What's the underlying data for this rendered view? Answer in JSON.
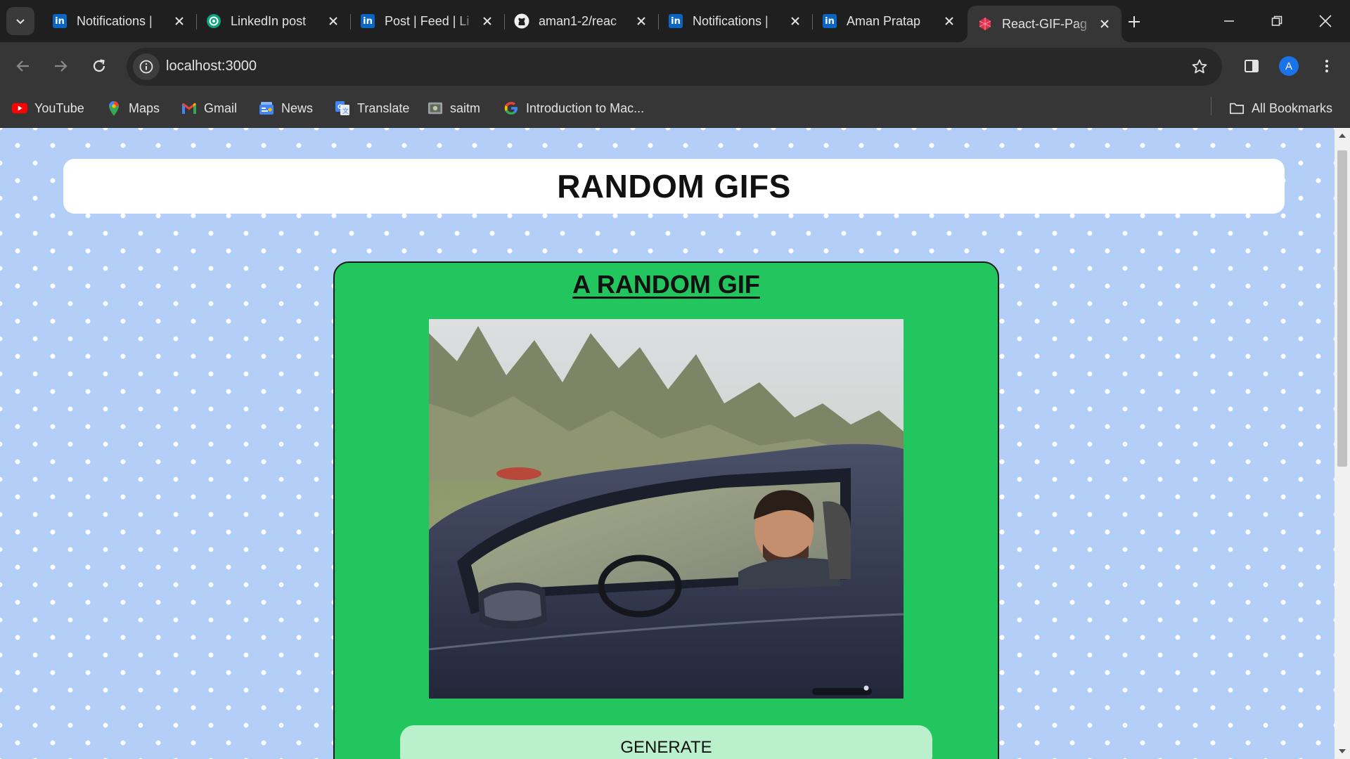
{
  "browser": {
    "tabs": [
      {
        "title": "Notifications |",
        "icon": "linkedin-icon"
      },
      {
        "title": "LinkedIn post",
        "icon": "chatgpt-icon"
      },
      {
        "title": "Post | Feed | Li",
        "icon": "linkedin-icon"
      },
      {
        "title": "aman1-2/reac",
        "icon": "github-icon"
      },
      {
        "title": "Notifications |",
        "icon": "linkedin-icon"
      },
      {
        "title": "Aman Pratap",
        "icon": "linkedin-icon"
      },
      {
        "title": "React-GIF-Pag",
        "icon": "react-gem-icon",
        "active": true
      }
    ],
    "address": "localhost:3000",
    "profile_initial": "A",
    "bookmarks": [
      {
        "label": "YouTube",
        "icon": "youtube-icon"
      },
      {
        "label": "Maps",
        "icon": "maps-icon"
      },
      {
        "label": "Gmail",
        "icon": "gmail-icon"
      },
      {
        "label": "News",
        "icon": "news-icon"
      },
      {
        "label": "Translate",
        "icon": "translate-icon"
      },
      {
        "label": "saitm",
        "icon": "saitm-icon"
      },
      {
        "label": "Introduction to Mac...",
        "icon": "google-icon"
      }
    ],
    "all_bookmarks_label": "All Bookmarks"
  },
  "page": {
    "header_title": "RANDOM GIFS",
    "card_title": "A RANDOM GIF",
    "generate_label": "GENERATE"
  },
  "colors": {
    "page_background": "#b3cff8",
    "card_green": "#22c55e",
    "button_mint": "#bbf0cc",
    "browser_dark": "#1f1f1f",
    "toolbar": "#363636"
  }
}
